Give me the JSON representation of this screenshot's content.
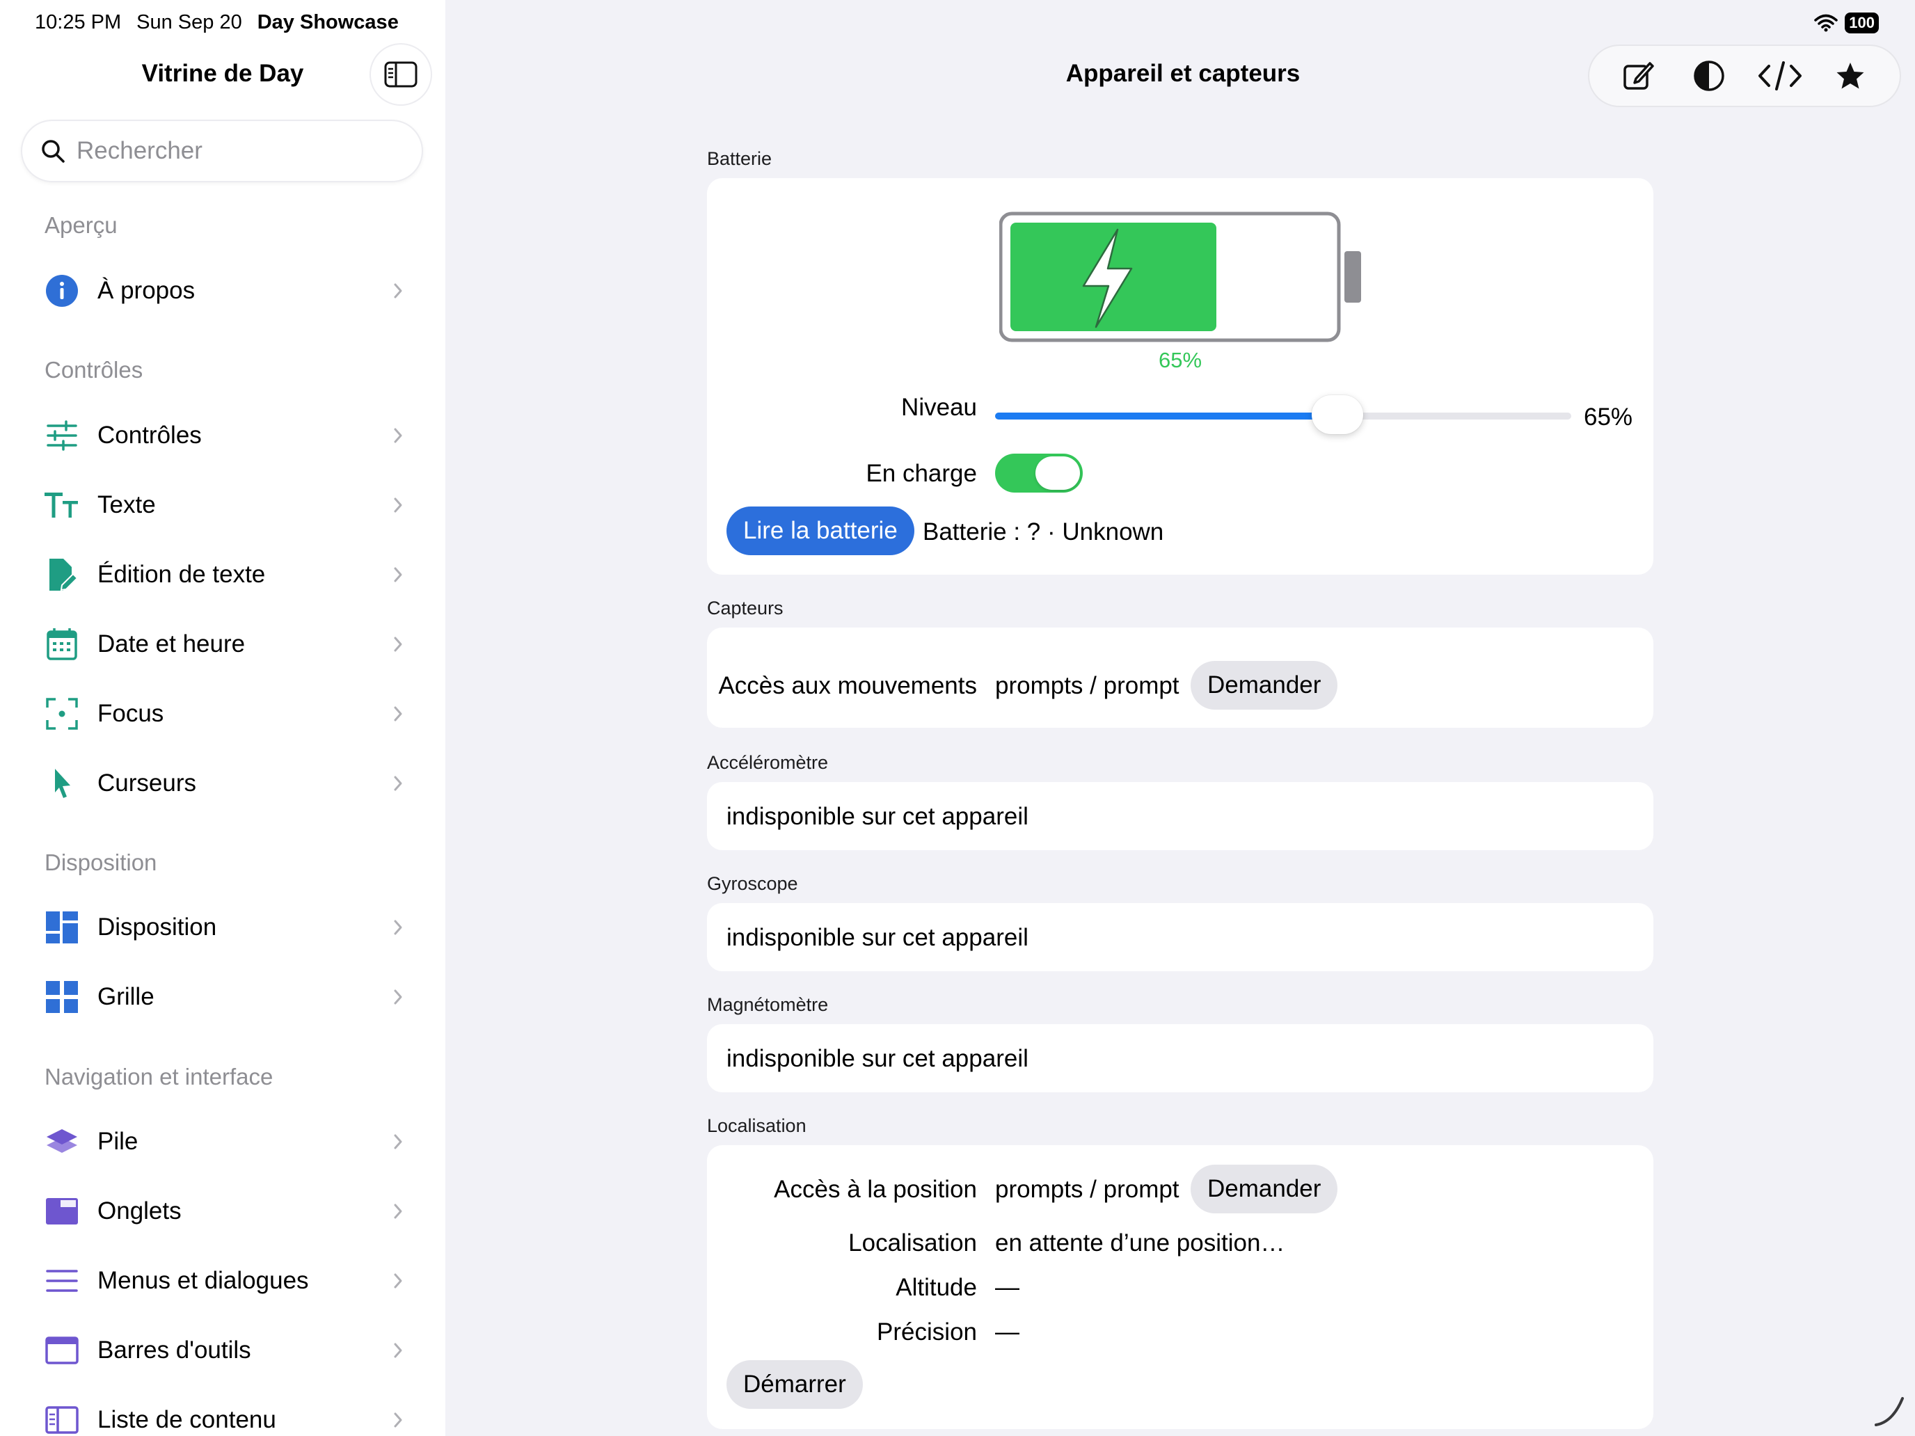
{
  "status_bar": {
    "time": "10:25 PM",
    "date": "Sun Sep 20",
    "app": "Day Showcase",
    "battery": "100"
  },
  "sidebar": {
    "title": "Vitrine de Day",
    "search_placeholder": "Rechercher",
    "sections": [
      {
        "header": "Aperçu",
        "items": [
          {
            "label": "À propos",
            "icon": "info-icon"
          }
        ]
      },
      {
        "header": "Contrôles",
        "items": [
          {
            "label": "Contrôles",
            "icon": "sliders-icon"
          },
          {
            "label": "Texte",
            "icon": "text-size-icon"
          },
          {
            "label": "Édition de texte",
            "icon": "document-edit-icon"
          },
          {
            "label": "Date et heure",
            "icon": "calendar-icon"
          },
          {
            "label": "Focus",
            "icon": "focus-icon"
          },
          {
            "label": "Curseurs",
            "icon": "cursor-icon"
          }
        ]
      },
      {
        "header": "Disposition",
        "items": [
          {
            "label": "Disposition",
            "icon": "layout-icon"
          },
          {
            "label": "Grille",
            "icon": "grid-icon"
          }
        ]
      },
      {
        "header": "Navigation et interface",
        "items": [
          {
            "label": "Pile",
            "icon": "stack-icon"
          },
          {
            "label": "Onglets",
            "icon": "tabs-icon"
          },
          {
            "label": "Menus et dialogues",
            "icon": "menu-lines-icon"
          },
          {
            "label": "Barres d'outils",
            "icon": "toolbar-icon"
          },
          {
            "label": "Liste de contenu",
            "icon": "content-list-icon"
          }
        ]
      }
    ]
  },
  "main": {
    "title": "Appareil et capteurs",
    "toolbar_icons": [
      "compose-icon",
      "contrast-icon",
      "code-icon",
      "star-icon"
    ],
    "battery": {
      "group_label": "Batterie",
      "percent_label": "65%",
      "level": 0.65,
      "level_label": "Niveau",
      "level_value": "65%",
      "charging_label": "En charge",
      "charging": true,
      "read_button": "Lire la batterie",
      "status": "Batterie : ? · Unknown"
    },
    "sensors": {
      "group_label": "Capteurs",
      "motion_label": "Accès aux mouvements",
      "motion_value": "prompts / prompt",
      "request_button": "Demander"
    },
    "accelerometer": {
      "group_label": "Accéléromètre",
      "value": "indisponible sur cet appareil"
    },
    "gyroscope": {
      "group_label": "Gyroscope",
      "value": "indisponible sur cet appareil"
    },
    "magnetometer": {
      "group_label": "Magnétomètre",
      "value": "indisponible sur cet appareil"
    },
    "location": {
      "group_label": "Localisation",
      "access_label": "Accès à la position",
      "access_value": "prompts / prompt",
      "request_button": "Demander",
      "location_label": "Localisation",
      "location_value": "en attente d’une position…",
      "altitude_label": "Altitude",
      "altitude_value": "—",
      "precision_label": "Précision",
      "precision_value": "—",
      "start_button": "Démarrer"
    }
  },
  "colors": {
    "accent": "#2c6fdc",
    "green": "#34c759",
    "teal_icon": "#1f9d83",
    "blue_icon": "#2f6fd6",
    "purple_icon": "#6e56cf"
  }
}
